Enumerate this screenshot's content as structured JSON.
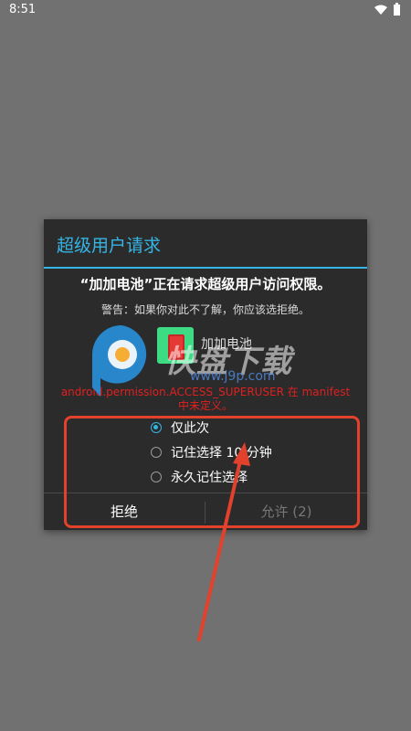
{
  "status_bar": {
    "time": "8:51",
    "wifi_icon": "wifi-icon",
    "battery_icon": "battery-icon"
  },
  "dialog": {
    "title": "超级用户请求",
    "message": "“加加电池”正在请求超级用户访问权限。",
    "warning": "警告：如果你对此不了解，你应该选拒绝。",
    "app_name": "加加电池",
    "error": "android.permission.ACCESS_SUPERUSER 在 manifest 中未定义。",
    "options": [
      {
        "label": "仅此次",
        "selected": true
      },
      {
        "label": "记住选择 10 分钟",
        "selected": false
      },
      {
        "label": "永久记住选择",
        "selected": false
      }
    ],
    "deny_label": "拒绝",
    "allow_label": "允许 (2)"
  },
  "watermark": {
    "text": "快盘下载",
    "url": "www.j9p.com"
  },
  "colors": {
    "accent": "#34b5e5",
    "dialog_bg": "#2b2b2b",
    "screen_bg": "#717171",
    "error": "#e02020",
    "annotation": "#e2412c"
  }
}
